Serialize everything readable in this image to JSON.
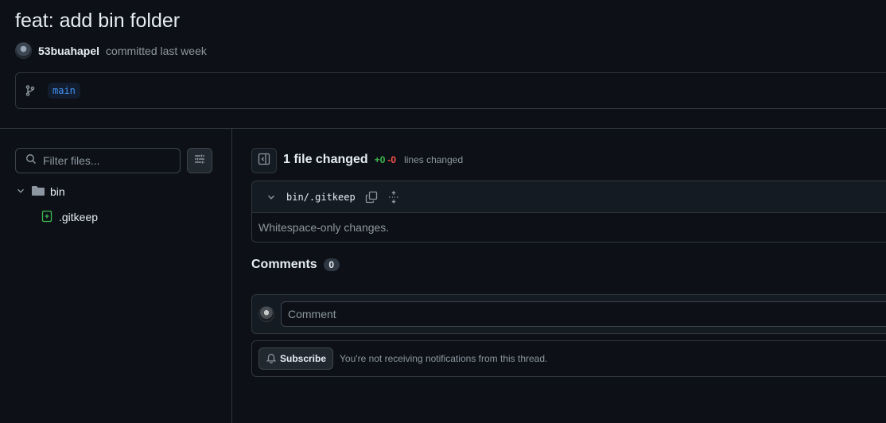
{
  "commit": {
    "title": "feat: add bin folder",
    "author": "53buahapel",
    "action": "committed last week",
    "branch": "main"
  },
  "sidebar": {
    "filter_placeholder": "Filter files...",
    "settings_icon": "sliders-icon",
    "tree": [
      {
        "type": "folder",
        "name": "bin"
      },
      {
        "type": "file",
        "name": ".gitkeep",
        "status": "added"
      }
    ]
  },
  "summary": {
    "files_changed": "1 file changed",
    "additions": "+0",
    "deletions": "-0",
    "lines_changed": "lines changed"
  },
  "file": {
    "path": "bin/.gitkeep",
    "body": "Whitespace-only changes."
  },
  "comments": {
    "label": "Comments",
    "count": "0",
    "placeholder": "Comment"
  },
  "subscribe": {
    "button": "Subscribe",
    "note": "You're not receiving notifications from this thread."
  },
  "colors": {
    "background": "#0d1117",
    "border": "#30363d",
    "added": "#3fb950",
    "deleted": "#f85149",
    "accent": "#4493f8"
  }
}
